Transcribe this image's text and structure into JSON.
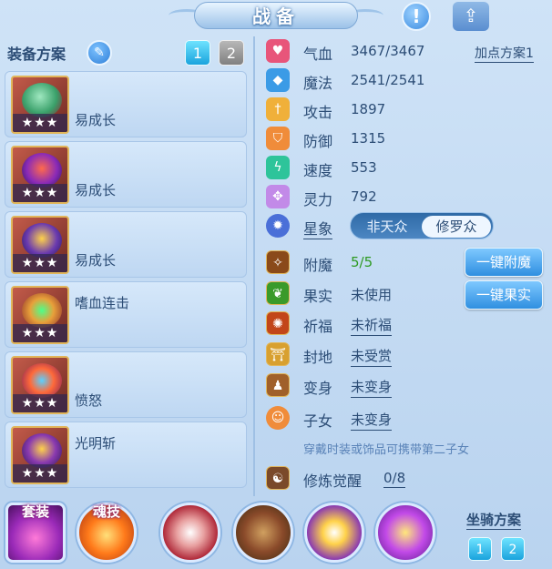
{
  "header": {
    "title": "战备",
    "alert_glyph": "!",
    "share_glyph": "⇪"
  },
  "equipment_plan": {
    "label": "装备方案",
    "edit_icon": "pencil-icon",
    "schemes": [
      "1",
      "2"
    ],
    "active_scheme": "1"
  },
  "equipment": [
    {
      "name": "易成长",
      "stars": "★★★"
    },
    {
      "name": "易成长",
      "stars": "★★★"
    },
    {
      "name": "易成长",
      "stars": "★★★"
    },
    {
      "name": "嗜血连击",
      "stars": "★★★"
    },
    {
      "name": "愤怒",
      "stars": "★★★"
    },
    {
      "name": "光明斩",
      "stars": "★★★"
    }
  ],
  "stats": [
    {
      "key": "气血",
      "value": "3467/3467",
      "icon": "heart-icon",
      "color": "#e8557a"
    },
    {
      "key": "魔法",
      "value": "2541/2541",
      "icon": "mana-icon",
      "color": "#3b9be6"
    },
    {
      "key": "攻击",
      "value": "1897",
      "icon": "sword-icon",
      "color": "#f0b03a"
    },
    {
      "key": "防御",
      "value": "1315",
      "icon": "shield-icon",
      "color": "#f08c3a"
    },
    {
      "key": "速度",
      "value": "553",
      "icon": "speed-icon",
      "color": "#2ec49a"
    },
    {
      "key": "灵力",
      "value": "792",
      "icon": "spirit-icon",
      "color": "#c28ae8"
    }
  ],
  "add_point_plan": "加点方案1",
  "star_sign": {
    "key": "星象",
    "options": [
      "非天众",
      "修罗众"
    ],
    "selected": "修罗众"
  },
  "extras": {
    "enchant": {
      "key": "附魔",
      "value": "5/5"
    },
    "fruit": {
      "key": "果实",
      "value": "未使用"
    },
    "blessing": {
      "key": "祈福",
      "value": "未祈福"
    },
    "fief": {
      "key": "封地",
      "value": "未受赏"
    },
    "transform": {
      "key": "变身",
      "value": "未变身"
    },
    "child": {
      "key": "子女",
      "value": "未变身"
    },
    "child_hint": "穿戴时装或饰品可携带第二子女",
    "awaken": {
      "key": "修炼觉醒",
      "value": "0/8"
    }
  },
  "buttons": {
    "one_click_enchant": "一键附魔",
    "one_click_fruit": "一键果实"
  },
  "bottom": {
    "costume": "套装",
    "soul_skill": "魂技",
    "mount_plan": "坐骑方案",
    "mount_schemes": [
      "1",
      "2"
    ]
  }
}
